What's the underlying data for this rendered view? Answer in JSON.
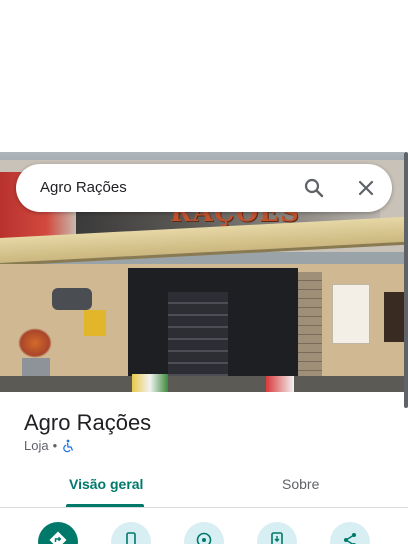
{
  "search": {
    "query": "Agro Rações"
  },
  "photo": {
    "sign_text": "RAÇÕES"
  },
  "place": {
    "name": "Agro Rações",
    "category": "Loja",
    "separator": "•"
  },
  "tabs": [
    {
      "label": "Visão geral",
      "active": true
    },
    {
      "label": "Sobre",
      "active": false
    }
  ],
  "actions": [
    {
      "icon": "directions-icon"
    },
    {
      "icon": "phone-icon"
    },
    {
      "icon": "nearby-icon"
    },
    {
      "icon": "send-to-phone-icon"
    },
    {
      "icon": "share-icon"
    }
  ],
  "colors": {
    "accent": "#00796b",
    "action_bg": "#d7eef3"
  }
}
